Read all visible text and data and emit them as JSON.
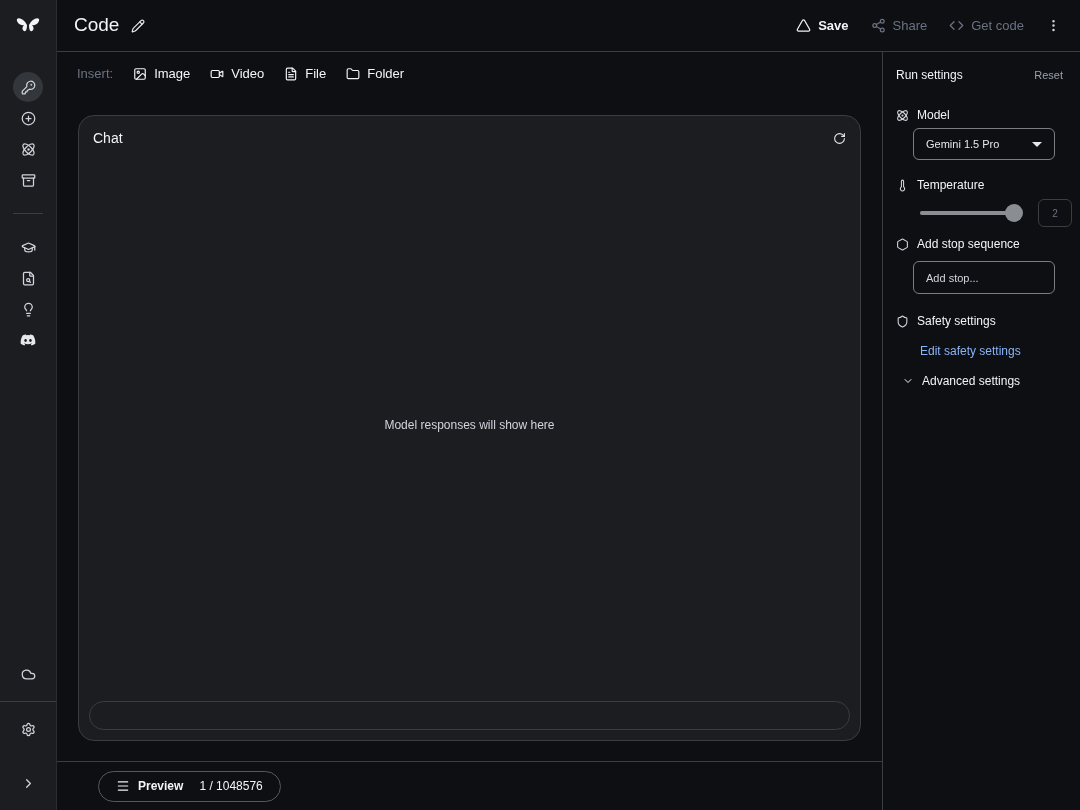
{
  "sidebar": {
    "top_items": [
      {
        "selected": true
      },
      {
        "selected": false
      },
      {
        "selected": false
      },
      {
        "selected": false
      }
    ],
    "bottom_items": [
      {
        "selected": false
      },
      {
        "selected": false
      },
      {
        "selected": false
      },
      {
        "selected": false
      }
    ]
  },
  "header": {
    "title": "Code",
    "actions": [
      {
        "kind": "save",
        "label": "Save",
        "disabled": false
      },
      {
        "kind": "share",
        "label": "Share",
        "disabled": true
      },
      {
        "kind": "code",
        "label": "Get code",
        "disabled": true
      }
    ]
  },
  "insert_bar": {
    "label": "Insert:",
    "items": [
      {
        "kind": "image",
        "label": "Image"
      },
      {
        "kind": "video",
        "label": "Video"
      },
      {
        "kind": "file",
        "label": "File"
      },
      {
        "kind": "folder",
        "label": "Folder"
      }
    ]
  },
  "chat": {
    "title": "Chat",
    "empty_message": "Model responses will show here"
  },
  "footer": {
    "preview_label": "Preview",
    "token_count": "1 / 1048576"
  },
  "run_settings": {
    "title": "Run settings",
    "reset": "Reset",
    "model_label": "Model",
    "model_value": "Gemini 1.5 Pro",
    "temperature_label": "Temperature",
    "temperature": {
      "level": 1.0,
      "reading": "2"
    },
    "stop_label": "Add stop sequence",
    "stop_placeholder": "Add stop...",
    "safety_label": "Safety settings",
    "safety_link": "Edit safety settings",
    "advanced_label": "Advanced settings",
    "advanced_expanded": false
  }
}
